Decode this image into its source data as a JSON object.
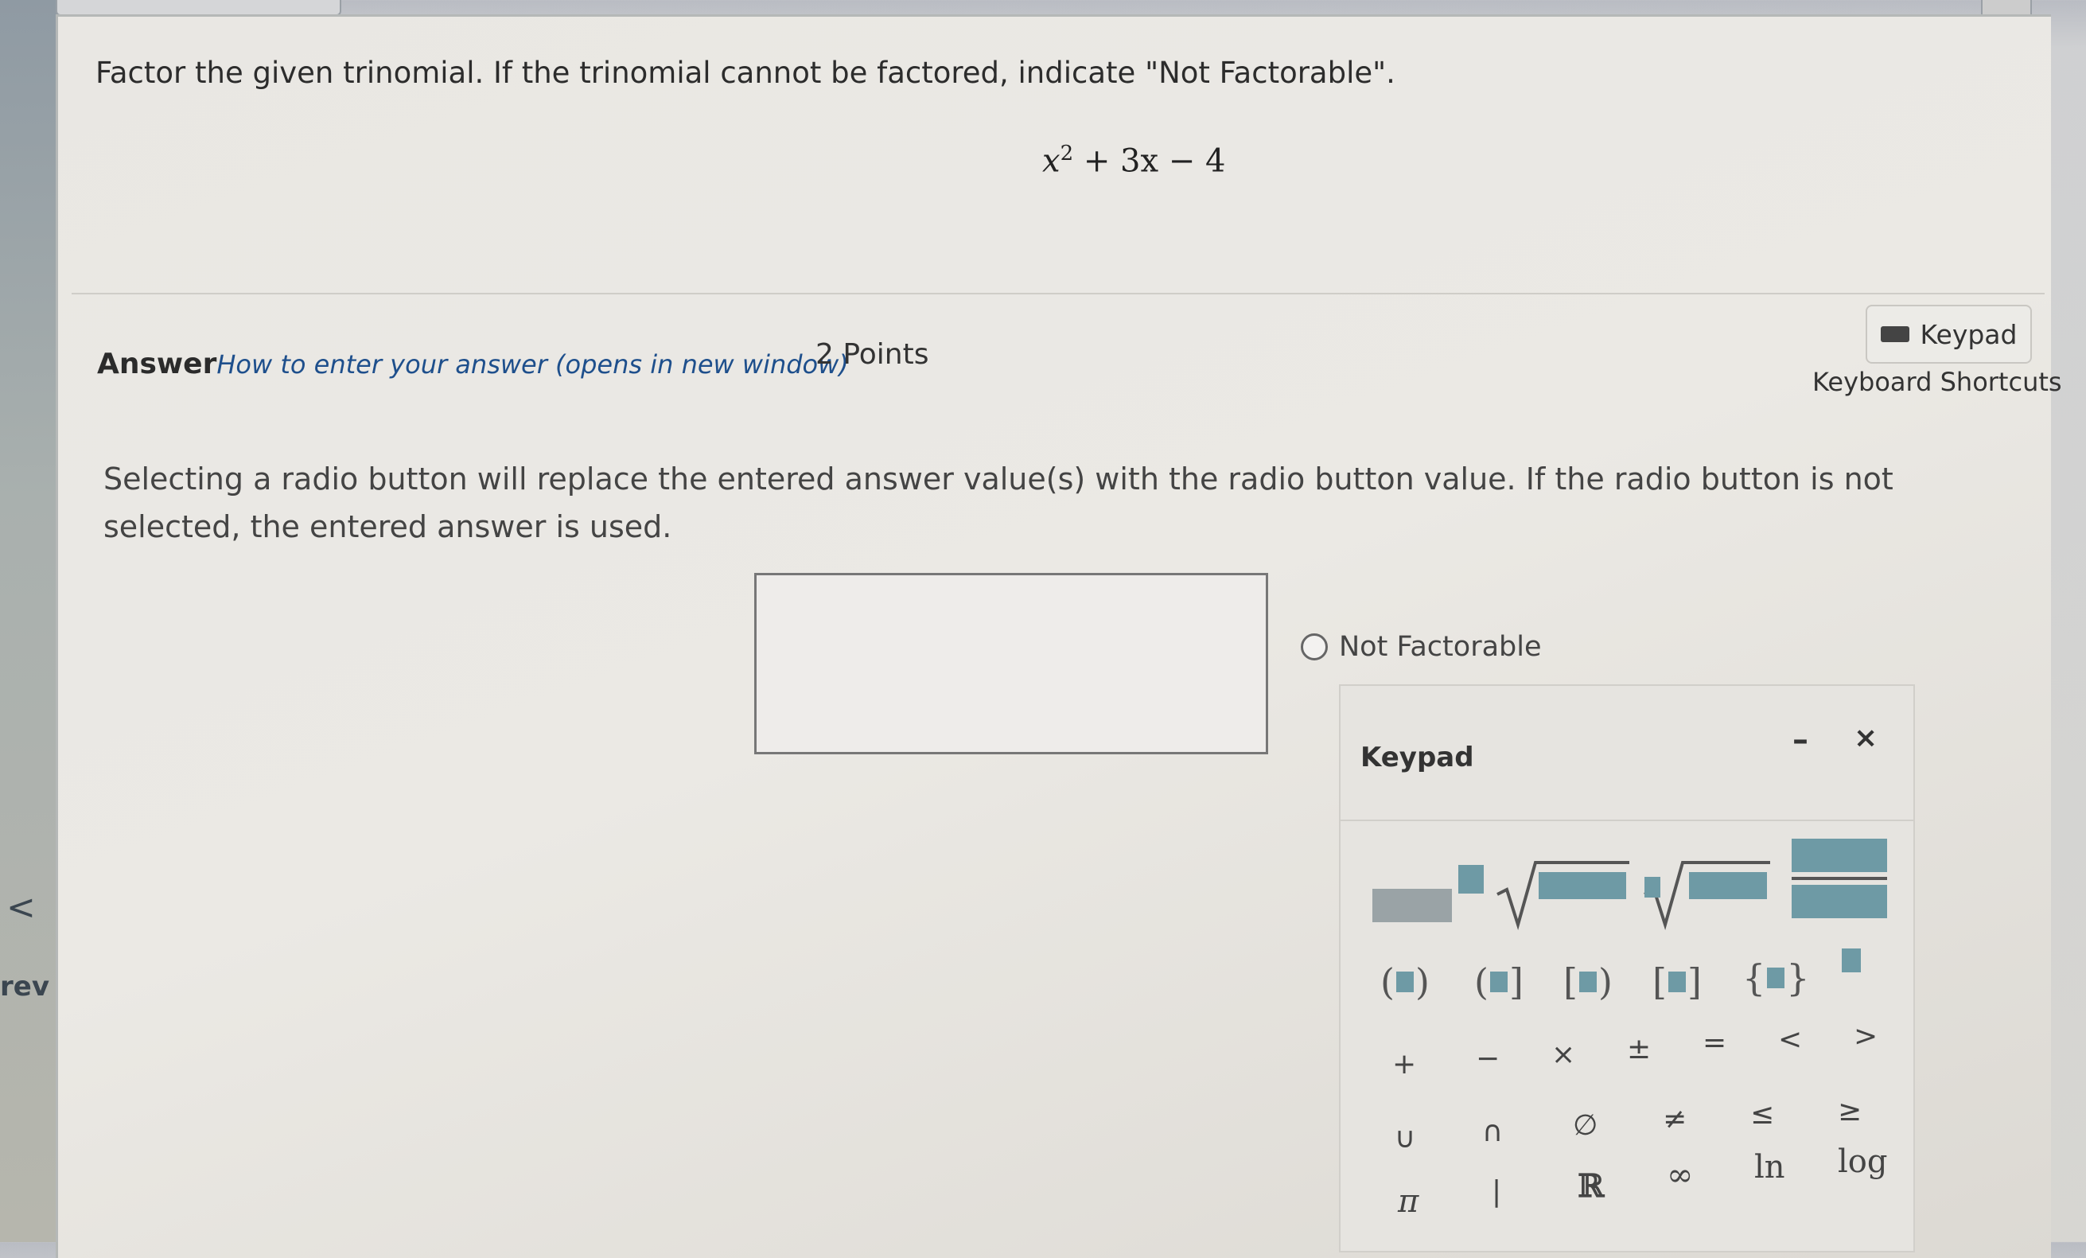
{
  "question": {
    "prompt": "Factor the given trinomial. If the trinomial cannot be factored, indicate \"Not Factorable\".",
    "expression_base": "x",
    "expression_exp": "2",
    "expression_rest": " + 3x − 4"
  },
  "answer": {
    "label": "Answer",
    "help_link": "How to enter your answer (opens in new window)",
    "points": "2 Points",
    "keypad_button": "Keypad",
    "keyboard_shortcuts": "Keyboard Shortcuts",
    "instructions": "Selecting a radio button will replace the entered answer value(s) with the radio button value. If the radio button is not selected, the entered answer is used.",
    "radio_label": "Not Factorable"
  },
  "keypad": {
    "title": "Keypad",
    "minimize": "–",
    "close": "×",
    "row_ops": [
      "+",
      "−",
      "×",
      "±",
      "=",
      "<",
      ">"
    ],
    "row_sets": [
      "∪",
      "∩",
      "∅",
      "≠",
      "≤",
      "≥"
    ],
    "row_consts": [
      "π",
      "|",
      "ℝ",
      "∞",
      "ln",
      "log"
    ]
  },
  "nav": {
    "prev_arrow": "<",
    "prev_label": "rev"
  }
}
